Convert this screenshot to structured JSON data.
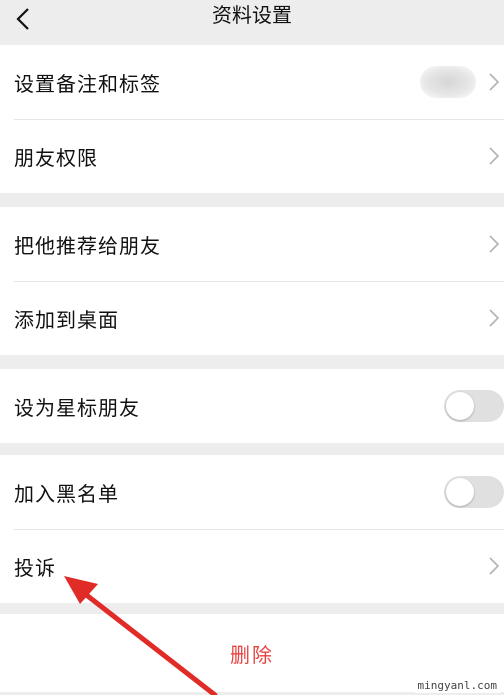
{
  "header": {
    "title": "资料设置",
    "back_icon": "chevron-left-icon"
  },
  "groups": {
    "g1": {
      "remark": "设置备注和标签",
      "permissions": "朋友权限"
    },
    "g2": {
      "recommend": "把他推荐给朋友",
      "desktop": "添加到桌面"
    },
    "g3": {
      "star": "设为星标朋友",
      "star_on": false
    },
    "g4": {
      "blacklist": "加入黑名单",
      "blacklist_on": false,
      "complain": "投诉"
    }
  },
  "actions": {
    "delete": "删除"
  },
  "colors": {
    "delete": "#e64340",
    "arrow": "#e02b27",
    "background": "#ededed"
  },
  "watermark": "mingyanl.com"
}
